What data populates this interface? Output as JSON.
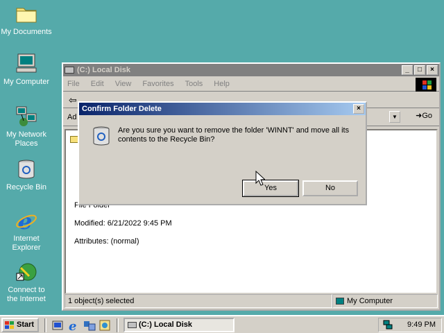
{
  "desktop": {
    "icons": [
      {
        "label": "My Documents",
        "icon": "folder-icon"
      },
      {
        "label": "My Computer",
        "icon": "computer-icon"
      },
      {
        "label_line1": "My Network",
        "label_line2": "Places",
        "icon": "network-icon"
      },
      {
        "label": "Recycle Bin",
        "icon": "recycle-bin-icon"
      },
      {
        "label_line1": "Internet",
        "label_line2": "Explorer",
        "icon": "ie-icon"
      },
      {
        "label_line1": "Connect to",
        "label_line2": "the Internet",
        "icon": "connect-icon"
      }
    ]
  },
  "explorer": {
    "title": "(C:) Local Disk",
    "menu": [
      "File",
      "Edit",
      "View",
      "Favorites",
      "Tools",
      "Help"
    ],
    "address_label": "Ad",
    "go_label": "Go",
    "details": {
      "type": "File Folder",
      "modified": "Modified: 6/21/2022 9:45 PM",
      "attributes": "Attributes: (normal)"
    },
    "status_selected": "1 object(s) selected",
    "status_zone": "My Computer"
  },
  "dialog": {
    "title": "Confirm Folder Delete",
    "message": "Are you sure you want to remove the folder 'WINNT' and move all its contents to the Recycle Bin?",
    "yes_label": "Yes",
    "no_label": "No"
  },
  "taskbar": {
    "start_label": "Start",
    "task_label": "(C:) Local Disk",
    "clock": "9:49 PM"
  },
  "colors": {
    "desktop": "#55aaaa",
    "active_title": "#0a246a",
    "inactive_title": "#808080",
    "face": "#d4d0c8"
  }
}
